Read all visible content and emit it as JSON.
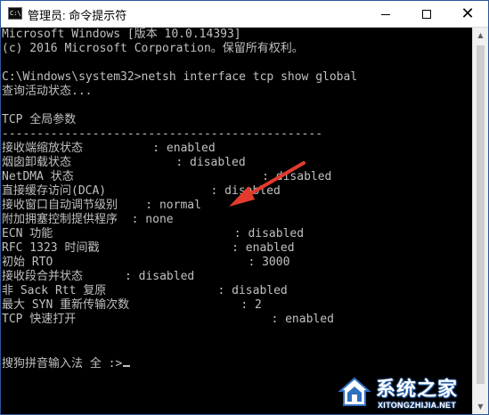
{
  "window": {
    "title": "管理员: 命令提示符",
    "icon_text": "C:\\",
    "controls": {
      "minimize": "minimize",
      "maximize": "maximize",
      "close": "✕"
    }
  },
  "console": {
    "lines": [
      "Microsoft Windows [版本 10.0.14393]",
      "(c) 2016 Microsoft Corporation。保留所有权利。",
      "",
      "C:\\Windows\\system32>netsh interface tcp show global",
      "查询活动状态...",
      "",
      "TCP 全局参数",
      "----------------------------------------------",
      "接收端缩放状态          : enabled",
      "烟囱卸载状态               : disabled",
      "NetDMA 状态                           : disabled",
      "直接缓存访问(DCA)               : disabled",
      "接收窗口自动调节级别    : normal",
      "附加拥塞控制提供程序  : none",
      "ECN 功能                          : disabled",
      "RFC 1323 时间戳                   : enabled",
      "初始 RTO                            : 3000",
      "接收段合并状态      : disabled",
      "非 Sack Rtt 复原                : disabled",
      "最大 SYN 重新传输次数                : 2",
      "TCP 快速打开                            : enabled",
      "",
      "",
      "搜狗拼音输入法 全 :>"
    ]
  },
  "watermark": {
    "brand_cn": "系统之家",
    "brand_en": "XITONGZHIJIA.NET"
  },
  "colors": {
    "console_bg": "#000000",
    "console_text": "#c0c0c0",
    "titlebar_bg": "#ffffff",
    "annotation_arrow": "#e23b2e",
    "watermark_blue": "#2f6fc0"
  }
}
